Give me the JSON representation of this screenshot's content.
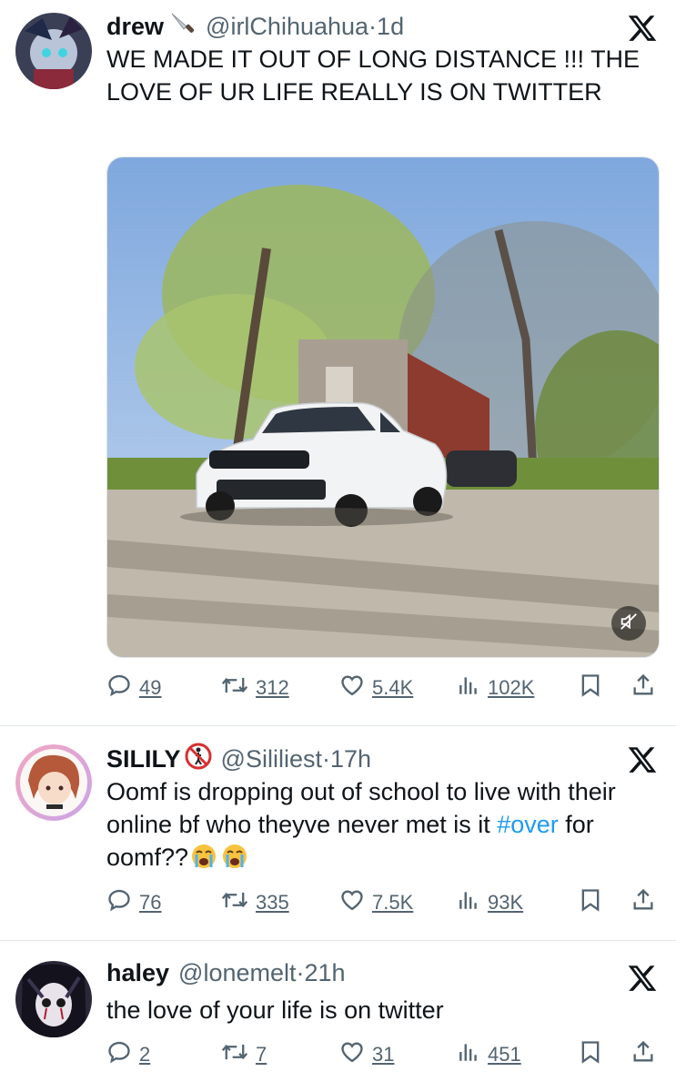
{
  "tweets": [
    {
      "name": "drew",
      "handle": "@irlChihuahua",
      "time": "1d",
      "text": "WE MADE IT OUT OF LONG DISTANCE !!! THE LOVE  OF UR LIFE REALLY IS ON TWITTER",
      "replies": "49",
      "retweets": "312",
      "likes": "5.4K",
      "views": "102K",
      "name_emoji": "knife-icon"
    },
    {
      "name": "SILILY",
      "handle": "@Sililiest",
      "time": "17h",
      "text_before": "Oomf is dropping out of school to live with their online bf who theyve never met is it ",
      "hashtag": "#over",
      "text_after": " for oomf??",
      "replies": "76",
      "retweets": "335",
      "likes": "7.5K",
      "views": "93K",
      "name_emoji": "no-pedestrians-icon"
    },
    {
      "name": "haley",
      "handle": "@lonemelt",
      "time": "21h",
      "text": "the love of your life is on twitter",
      "replies": "2",
      "retweets": "7",
      "likes": "31",
      "views": "451"
    }
  ],
  "separator": " · ",
  "colors": {
    "text": "#0f1419",
    "muted": "#536471",
    "link": "#1d9bf0",
    "divider": "#e3e6e8"
  }
}
